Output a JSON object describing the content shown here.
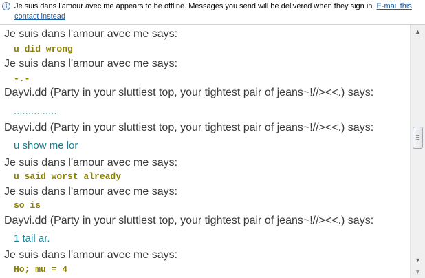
{
  "infobar": {
    "icon": "info-icon",
    "message": "Je suis dans l'amour avec me appears to be offline. Messages you send will be delivered when they sign in.",
    "link_label": "E-mail this contact instead"
  },
  "messages": [
    {
      "sender": "Je suis dans l'amour avec me says:",
      "text": "u did wrong",
      "style": "mono"
    },
    {
      "sender": "Je suis dans l'amour avec me says:",
      "text": "-.-",
      "style": "mono"
    },
    {
      "sender": "Dayvi.dd (Party in your sluttiest top, your tightest pair of jeans~!//><<.) says:",
      "text": "...............",
      "style": "sans"
    },
    {
      "sender": "Dayvi.dd (Party in your sluttiest top, your tightest pair of jeans~!//><<.) says:",
      "text": "u show me lor",
      "style": "sans"
    },
    {
      "sender": "Je suis dans l'amour avec me says:",
      "text": "u said worst already",
      "style": "mono"
    },
    {
      "sender": "Je suis dans l'amour avec me says:",
      "text": "so is",
      "style": "mono"
    },
    {
      "sender": "Dayvi.dd (Party in your sluttiest top, your tightest pair of jeans~!//><<.) says:",
      "text": "1 tail ar.",
      "style": "sans"
    },
    {
      "sender": "Je suis dans l'amour avec me says:",
      "text": "Ho; mu = 4",
      "style": "mono"
    }
  ],
  "scrollbar": {
    "up_icon": "arrow-up-icon",
    "down_icon": "arrow-down-icon"
  }
}
